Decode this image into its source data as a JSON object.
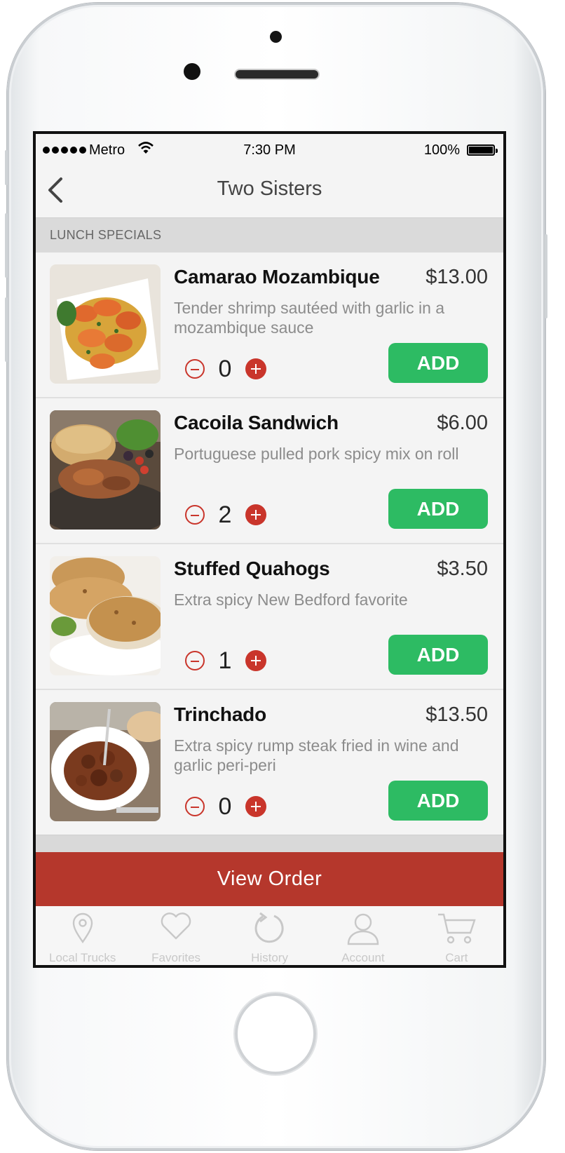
{
  "status_bar": {
    "carrier": "Metro",
    "time": "7:30 PM",
    "battery": "100%"
  },
  "nav": {
    "title": "Two Sisters"
  },
  "section": {
    "label": "LUNCH SPECIALS"
  },
  "items": [
    {
      "name": "Camarao Mozambique",
      "price": "$13.00",
      "description": "Tender shrimp sautéed with garlic in a mozambique sauce",
      "quantity": "0",
      "add_label": "ADD"
    },
    {
      "name": "Cacoila Sandwich",
      "price": "$6.00",
      "description": "Portuguese pulled pork spicy mix on roll",
      "quantity": "2",
      "add_label": "ADD"
    },
    {
      "name": "Stuffed Quahogs",
      "price": "$3.50",
      "description": "Extra spicy New Bedford favorite",
      "quantity": "1",
      "add_label": "ADD"
    },
    {
      "name": "Trinchado",
      "price": "$13.50",
      "description": "Extra spicy rump steak fried in wine and garlic peri-peri",
      "quantity": "0",
      "add_label": "ADD"
    }
  ],
  "view_order": {
    "label": "View Order"
  },
  "tabs": [
    {
      "label": "Local Trucks",
      "icon": "location-pin-icon"
    },
    {
      "label": "Favorites",
      "icon": "heart-icon"
    },
    {
      "label": "History",
      "icon": "history-icon"
    },
    {
      "label": "Account",
      "icon": "account-icon"
    },
    {
      "label": "Cart",
      "icon": "cart-icon"
    }
  ],
  "colors": {
    "accent_red": "#b5372c",
    "add_green": "#2dbb63",
    "stepper_red": "#c9352b"
  }
}
